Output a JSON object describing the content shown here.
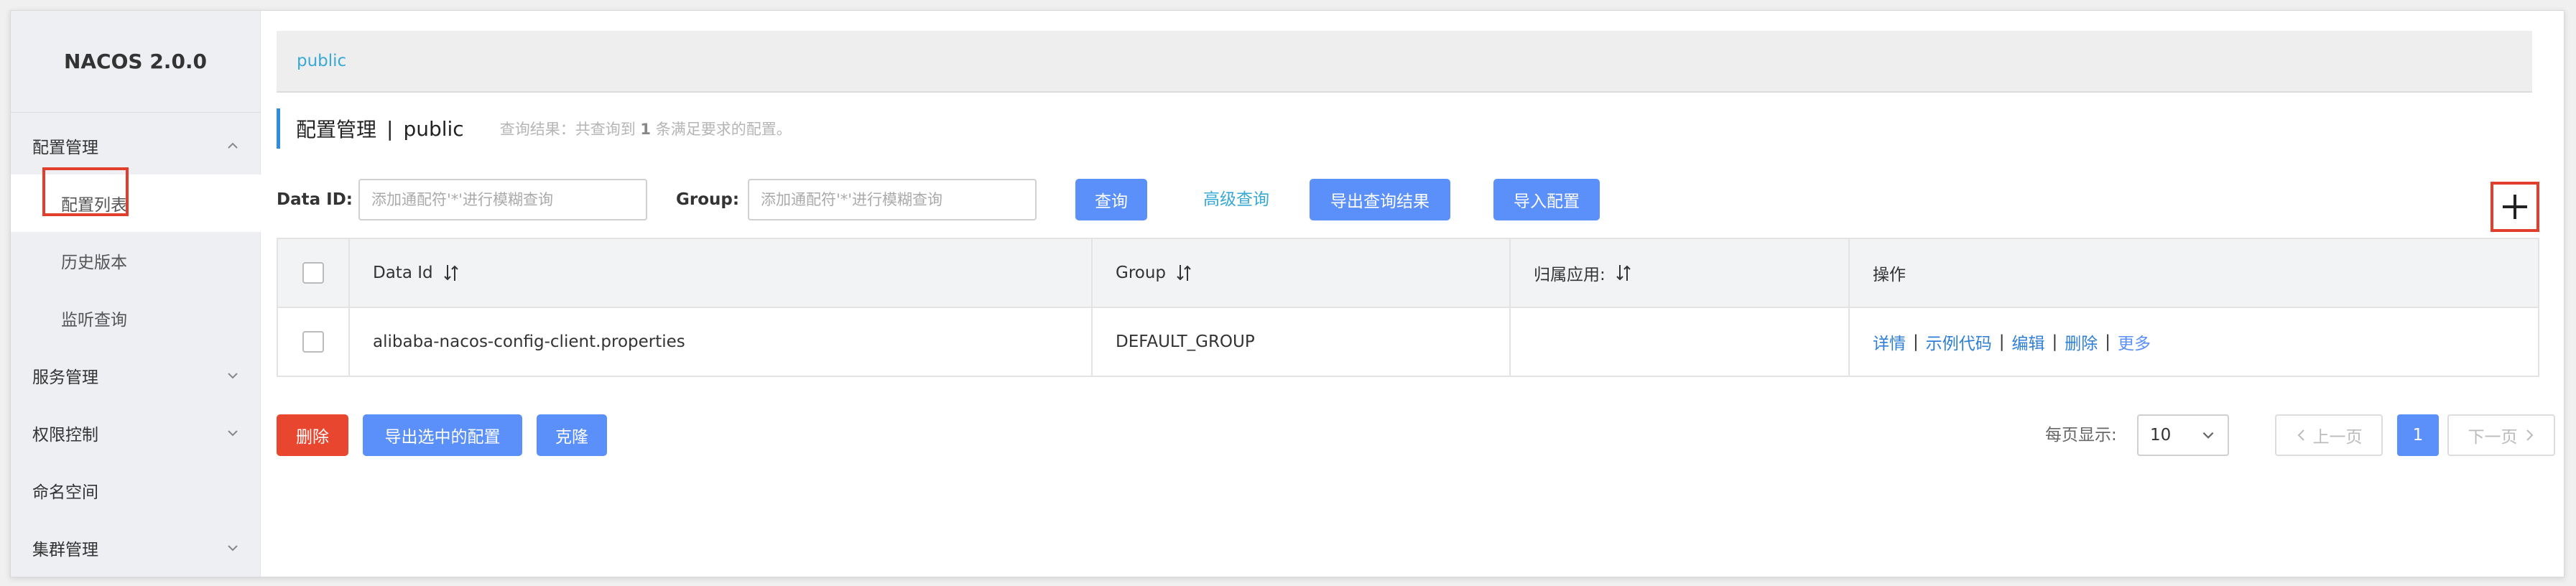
{
  "app": {
    "title": "NACOS 2.0.0"
  },
  "sidebar": {
    "groups": [
      {
        "label": "配置管理",
        "expanded": true
      },
      {
        "label": "服务管理",
        "expanded": false
      },
      {
        "label": "权限控制",
        "expanded": false
      },
      {
        "label": "命名空间"
      },
      {
        "label": "集群管理",
        "expanded": false
      }
    ],
    "items": [
      {
        "label": "配置列表",
        "active": true
      },
      {
        "label": "历史版本"
      },
      {
        "label": "监听查询"
      }
    ]
  },
  "breadcrumb": {
    "namespace": "public"
  },
  "header": {
    "title": "配置管理",
    "separator": "|",
    "namespace": "public",
    "result_prefix": "查询结果：共查询到",
    "result_count": "1",
    "result_suffix": "条满足要求的配置。"
  },
  "search": {
    "data_id_label": "Data ID:",
    "data_id_placeholder": "添加通配符'*'进行模糊查询",
    "group_label": "Group:",
    "group_placeholder": "添加通配符'*'进行模糊查询",
    "query_button": "查询",
    "advanced_link": "高级查询",
    "export_results_button": "导出查询结果",
    "import_button": "导入配置",
    "add_button": "+"
  },
  "table": {
    "columns": [
      "Data Id",
      "Group",
      "归属应用:",
      "操作"
    ],
    "rows": [
      {
        "data_id": "alibaba-nacos-config-client.properties",
        "group": "DEFAULT_GROUP",
        "app": "",
        "actions": [
          "详情",
          "示例代码",
          "编辑",
          "删除",
          "更多"
        ]
      }
    ]
  },
  "footer": {
    "delete_button": "删除",
    "export_selected_button": "导出选中的配置",
    "clone_button": "克隆",
    "page_size_label": "每页显示:",
    "page_size": "10",
    "prev_button": "上一页",
    "current_page": "1",
    "next_button": "下一页"
  },
  "colors": {
    "primary": "#5b8ff9",
    "danger": "#e8462e",
    "link": "#39a9d6",
    "highlight_box": "#e23e2c"
  }
}
